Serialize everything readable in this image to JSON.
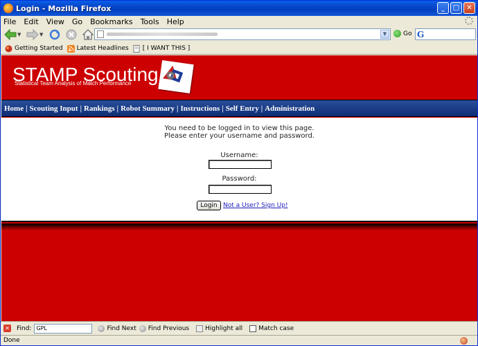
{
  "window": {
    "title": "Login - Mozilla Firefox"
  },
  "menu": [
    "File",
    "Edit",
    "View",
    "Go",
    "Bookmarks",
    "Tools",
    "Help"
  ],
  "nav": {
    "go_label": "Go"
  },
  "bookmarks": [
    {
      "label": "Getting Started",
      "icon": "firefox-bookmark-icon"
    },
    {
      "label": "Latest Headlines",
      "icon": "rss-feed-icon"
    },
    {
      "label": "[ I WANT THIS ]",
      "icon": "page-icon"
    }
  ],
  "site": {
    "title": "STAMP Scouting",
    "subtitle": "Statistical Team Analysis of Match Performance",
    "nav_links": [
      "Home",
      "Scouting Input",
      "Rankings",
      "Robot Summary",
      "Instructions",
      "Self Entry",
      "Administration"
    ]
  },
  "login": {
    "message_line1": "You need to be logged in to view this page.",
    "message_line2": "Please enter your username and password.",
    "username_label": "Username:",
    "password_label": "Password:",
    "button_label": "Login",
    "signup_link": "Not a User? Sign Up!"
  },
  "findbar": {
    "find_label": "Find:",
    "find_value": "GPL",
    "find_next": "Find Next",
    "find_previous": "Find Previous",
    "highlight_all": "Highlight all",
    "match_case": "Match case"
  },
  "status": {
    "text": "Done"
  },
  "colors": {
    "banner_red": "#CC0000",
    "nav_blue": "#1A3A86",
    "link_blue": "#1A1AB8"
  }
}
